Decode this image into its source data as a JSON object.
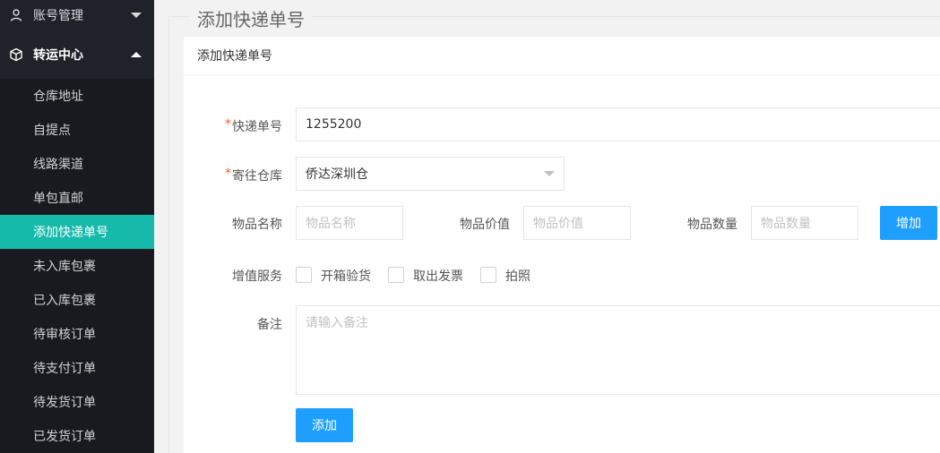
{
  "sidebar": {
    "account": {
      "label": "账号管理"
    },
    "transfer": {
      "label": "转运中心"
    },
    "items": [
      {
        "label": "仓库地址"
      },
      {
        "label": "自提点"
      },
      {
        "label": "线路渠道"
      },
      {
        "label": "单包直邮"
      },
      {
        "label": "添加快递单号"
      },
      {
        "label": "未入库包裹"
      },
      {
        "label": "已入库包裹"
      },
      {
        "label": "待审核订单"
      },
      {
        "label": "待支付订单"
      },
      {
        "label": "待发货订单"
      },
      {
        "label": "已发货订单"
      }
    ],
    "selected_index": 4
  },
  "page": {
    "legend": "添加快递单号",
    "card_title": "添加快递单号"
  },
  "form": {
    "tracking": {
      "required_mark": "*",
      "label": "快递单号",
      "value": "1255200"
    },
    "warehouse": {
      "required_mark": "*",
      "label": "寄往仓库",
      "value": "侨达深圳仓"
    },
    "item_name": {
      "label": "物品名称",
      "placeholder": "物品名称"
    },
    "item_value": {
      "label": "物品价值",
      "placeholder": "物品价值"
    },
    "item_qty": {
      "label": "物品数量",
      "placeholder": "物品数量"
    },
    "add_item_button": "增加",
    "services": {
      "label": "增值服务",
      "options": [
        {
          "label": "开箱验货",
          "checked": false
        },
        {
          "label": "取出发票",
          "checked": false
        },
        {
          "label": "拍照",
          "checked": false
        }
      ]
    },
    "remark": {
      "label": "备注",
      "placeholder": "请输入备注"
    },
    "submit_button": "添加"
  },
  "colors": {
    "sidebar_bg": "#20222a",
    "submenu_bg": "#191a1f",
    "selected_bg": "#16baaa",
    "button_blue": "#1e9fff",
    "required_red": "#ff5722"
  },
  "icons": {
    "account": "user-icon",
    "transfer": "cube-icon",
    "account_caret": "caret-down-icon",
    "transfer_caret": "caret-up-icon",
    "select_caret": "caret-down-icon"
  }
}
